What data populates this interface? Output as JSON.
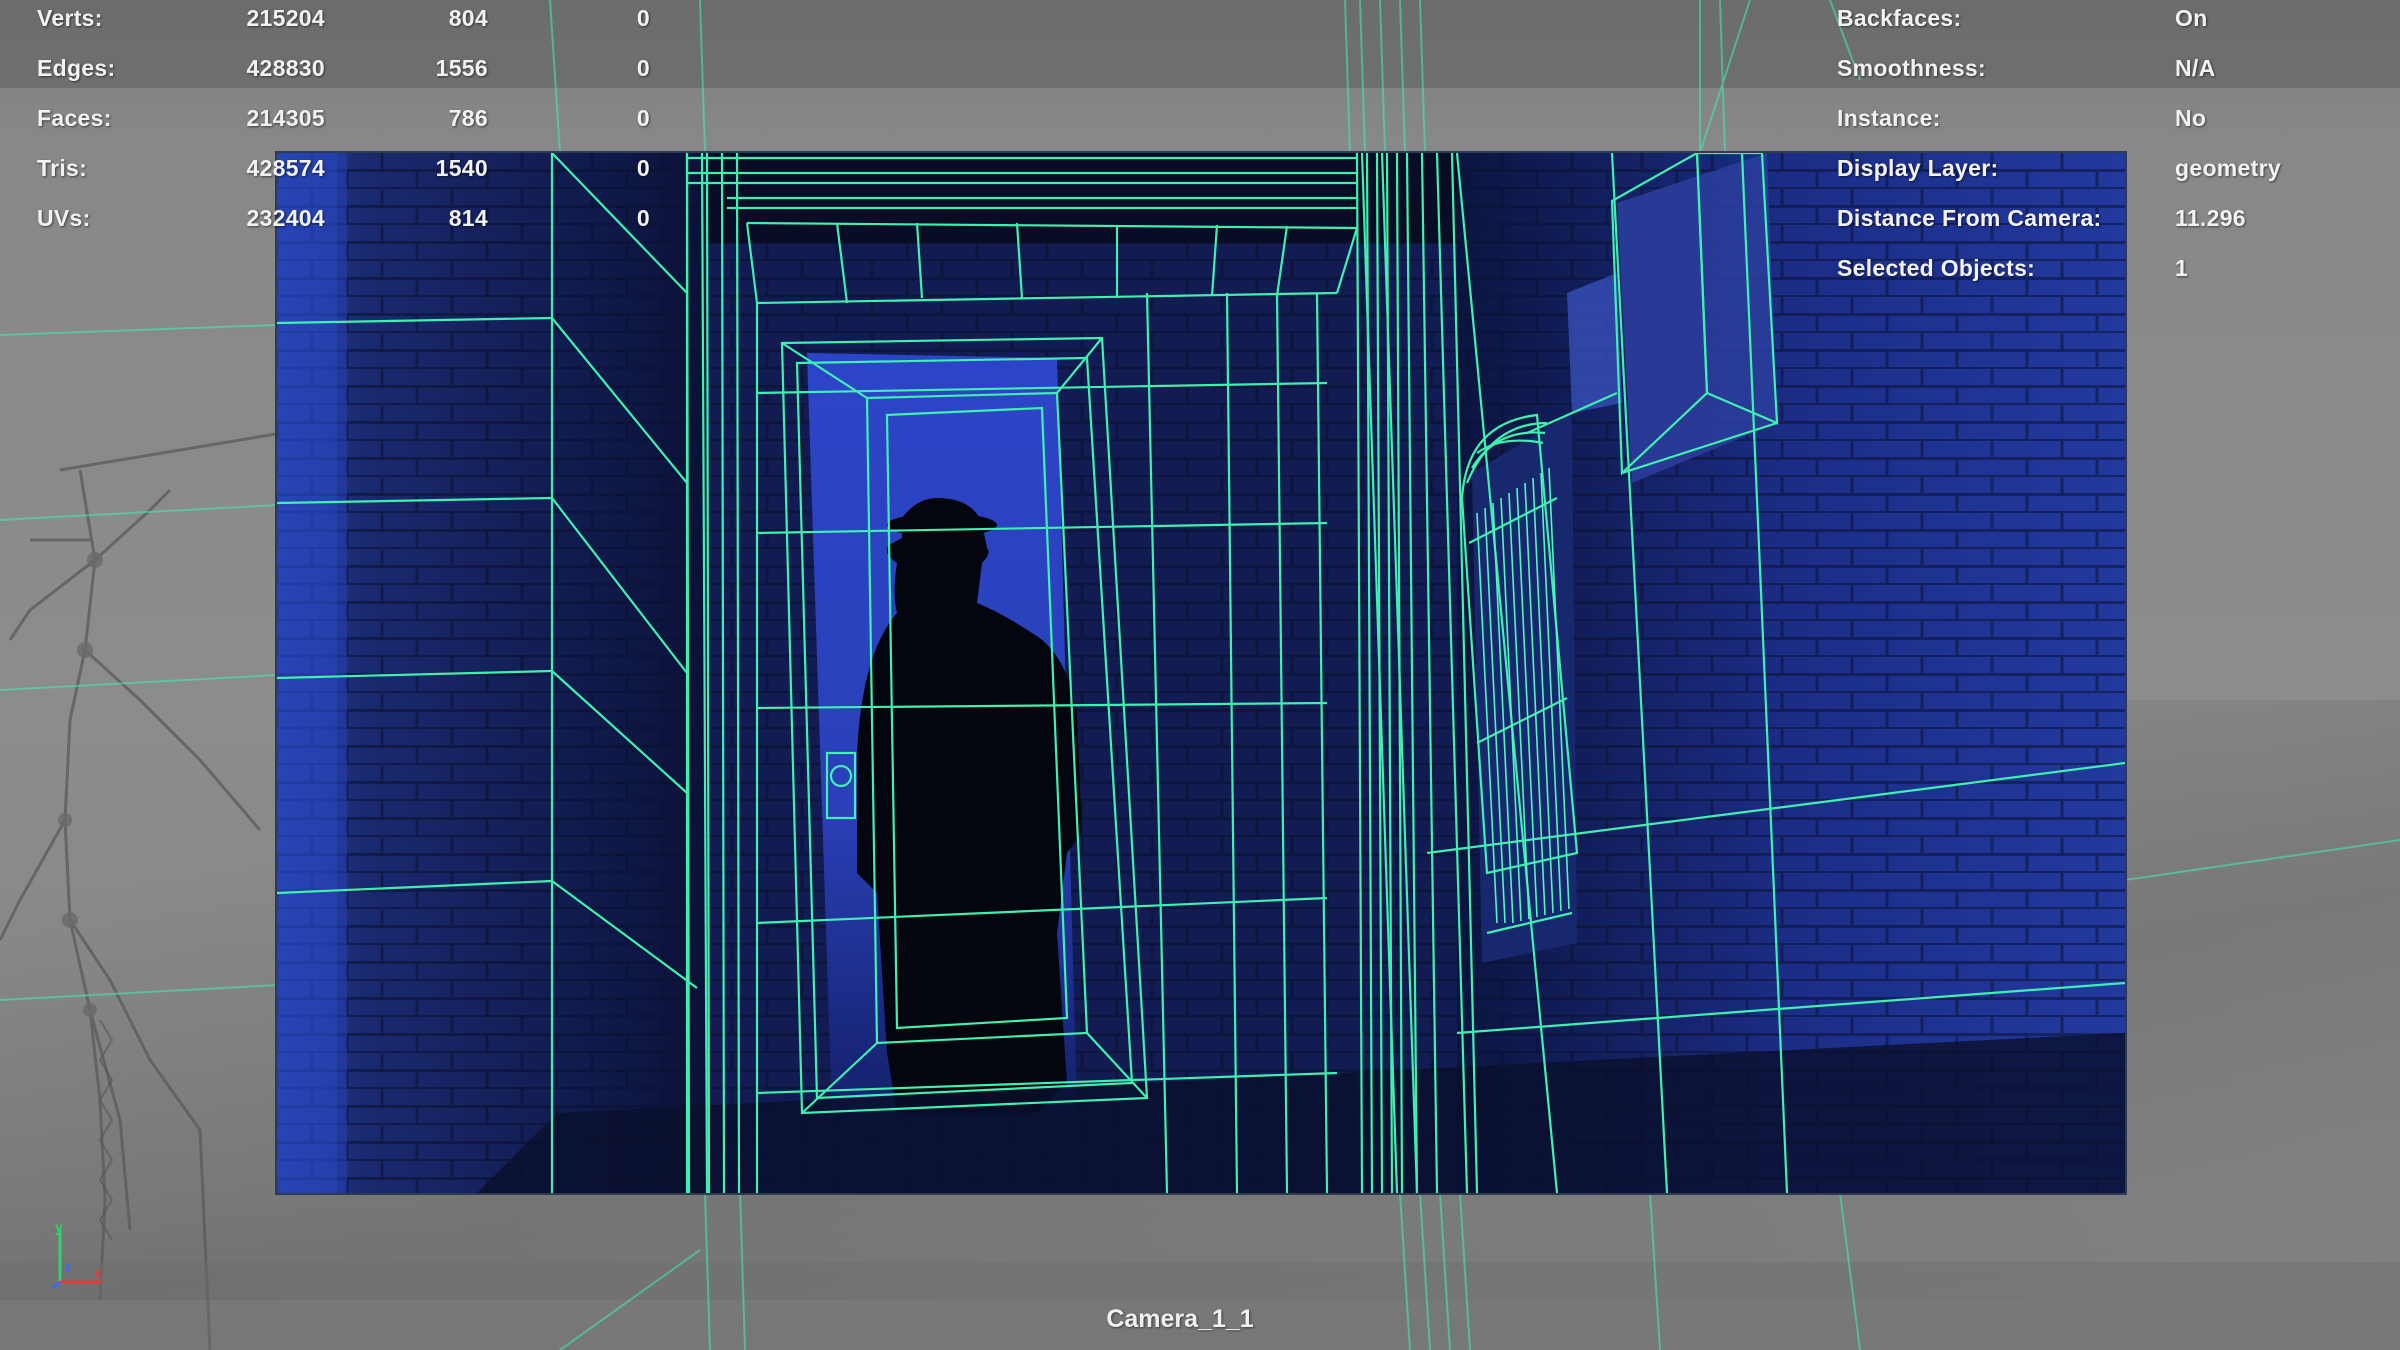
{
  "viewport": {
    "camera_name": "Camera_1_1"
  },
  "heads_up_display": {
    "poly_count": {
      "rows": [
        {
          "label": "Verts:",
          "scene": "215204",
          "selected": "804",
          "components": "0"
        },
        {
          "label": "Edges:",
          "scene": "428830",
          "selected": "1556",
          "components": "0"
        },
        {
          "label": "Faces:",
          "scene": "214305",
          "selected": "786",
          "components": "0"
        },
        {
          "label": "Tris:",
          "scene": "428574",
          "selected": "1540",
          "components": "0"
        },
        {
          "label": "UVs:",
          "scene": "232404",
          "selected": "814",
          "components": "0"
        }
      ]
    },
    "object_details": {
      "rows": [
        {
          "label": "Backfaces:",
          "value": "On"
        },
        {
          "label": "Smoothness:",
          "value": "N/A"
        },
        {
          "label": "Instance:",
          "value": "No"
        },
        {
          "label": "Display Layer:",
          "value": "geometry"
        },
        {
          "label": "Distance From Camera:",
          "value": "11.296"
        },
        {
          "label": "Selected Objects:",
          "value": "1"
        }
      ]
    }
  },
  "axis_indicator": {
    "labels": {
      "y": "y",
      "z": "z",
      "x": "x"
    },
    "colors": {
      "y": "#34d06a",
      "z": "#3a6cf0",
      "x": "#e23a3a"
    }
  },
  "colors": {
    "wireframe": "#3ff0b0",
    "wireframe_dim": "#5ad8a8",
    "plate_tint": "#1c2f9a",
    "hud_text": "#f2f2f2"
  }
}
